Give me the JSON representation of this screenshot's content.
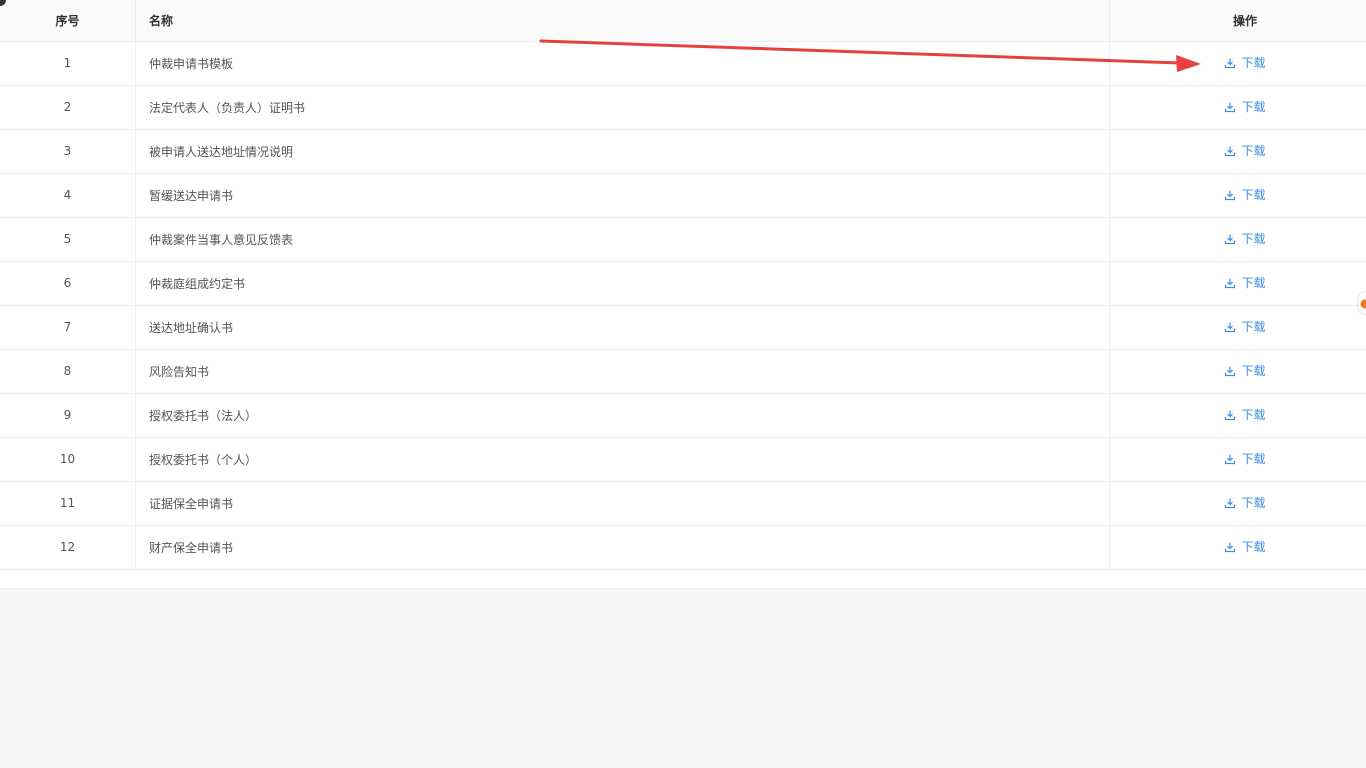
{
  "table": {
    "headers": {
      "index": "序号",
      "name": "名称",
      "action": "操作"
    },
    "rows": [
      {
        "index": "1",
        "name": "仲裁申请书模板",
        "action": "下载"
      },
      {
        "index": "2",
        "name": "法定代表人（负责人）证明书",
        "action": "下载"
      },
      {
        "index": "3",
        "name": "被申请人送达地址情况说明",
        "action": "下载"
      },
      {
        "index": "4",
        "name": "暂缓送达申请书",
        "action": "下载"
      },
      {
        "index": "5",
        "name": "仲裁案件当事人意见反馈表",
        "action": "下载"
      },
      {
        "index": "6",
        "name": "仲裁庭组成约定书",
        "action": "下载"
      },
      {
        "index": "7",
        "name": "送达地址确认书",
        "action": "下载"
      },
      {
        "index": "8",
        "name": "风险告知书",
        "action": "下载"
      },
      {
        "index": "9",
        "name": "授权委托书（法人）",
        "action": "下载"
      },
      {
        "index": "10",
        "name": "授权委托书（个人）",
        "action": "下载"
      },
      {
        "index": "11",
        "name": "证据保全申请书",
        "action": "下载"
      },
      {
        "index": "12",
        "name": "财产保全申请书",
        "action": "下载"
      }
    ]
  },
  "icons": {
    "download": "download-icon",
    "side_widget": "orange-widget-icon"
  },
  "colors": {
    "link": "#3a8ee6",
    "annotation_arrow": "#e8403f",
    "border": "#ebeef5",
    "page_background": "#f5f6f8"
  }
}
